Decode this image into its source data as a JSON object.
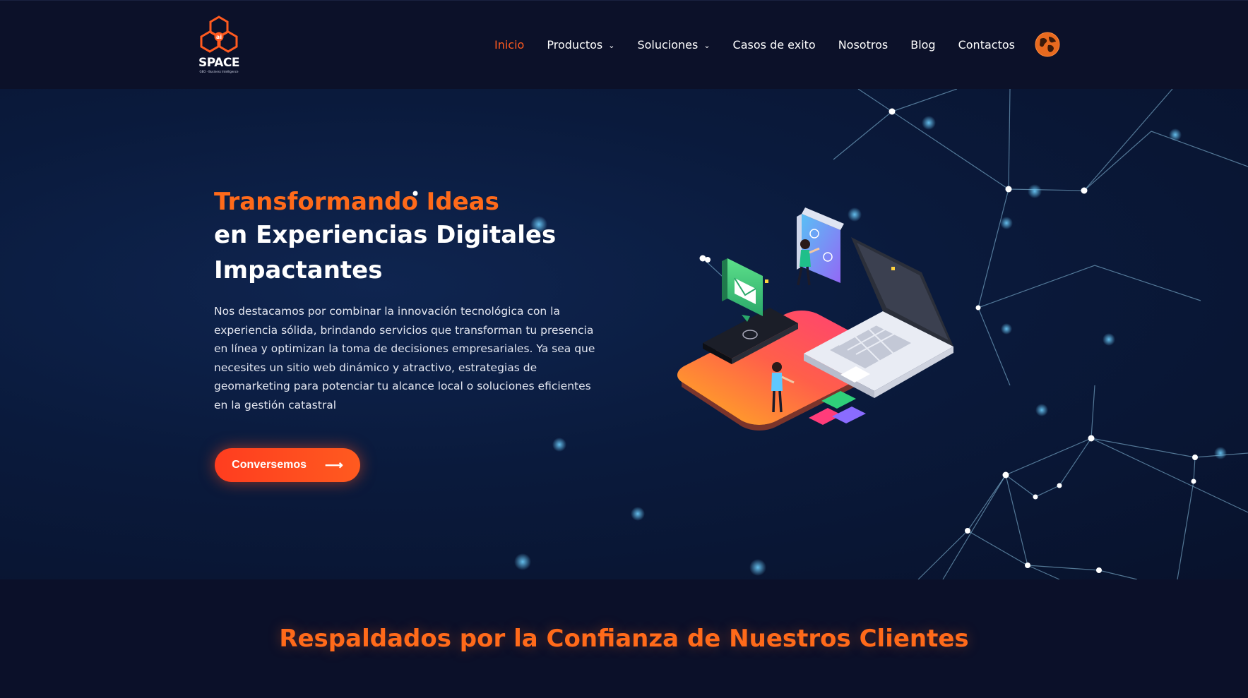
{
  "brand": {
    "name": "SPACE",
    "tagline": "GEO - Business Intelligence",
    "badge": "ai"
  },
  "nav": {
    "items": [
      {
        "label": "Inicio",
        "active": true,
        "dropdown": false
      },
      {
        "label": "Productos",
        "active": false,
        "dropdown": true
      },
      {
        "label": "Soluciones",
        "active": false,
        "dropdown": true
      },
      {
        "label": "Casos de exito",
        "active": false,
        "dropdown": false
      },
      {
        "label": "Nosotros",
        "active": false,
        "dropdown": false
      },
      {
        "label": "Blog",
        "active": false,
        "dropdown": false
      },
      {
        "label": "Contactos",
        "active": false,
        "dropdown": false
      }
    ],
    "language_icon": "globe-icon"
  },
  "hero": {
    "title_highlight": "Transformando Ideas",
    "title_line2": "en Experiencias Digitales",
    "title_line3": "Impactantes",
    "description": "Nos destacamos por combinar la innovación tecnológica con la experiencia sólida, brindando servicios que transforman tu presencia en línea y optimizan la toma de decisiones empresariales. Ya sea que necesites un sitio web dinámico y atractivo, estrategias de geomarketing para potenciar tu alcance local o soluciones eficientes en la gestión catastral",
    "cta_label": "Conversemos",
    "cta_icon": "arrow-right-icon"
  },
  "clients": {
    "title": "Respaldados por la Confianza de Nuestros Clientes"
  },
  "colors": {
    "accent": "#ff5a1f",
    "background": "#0b1029",
    "hero_bg": "#0a1a3c"
  }
}
